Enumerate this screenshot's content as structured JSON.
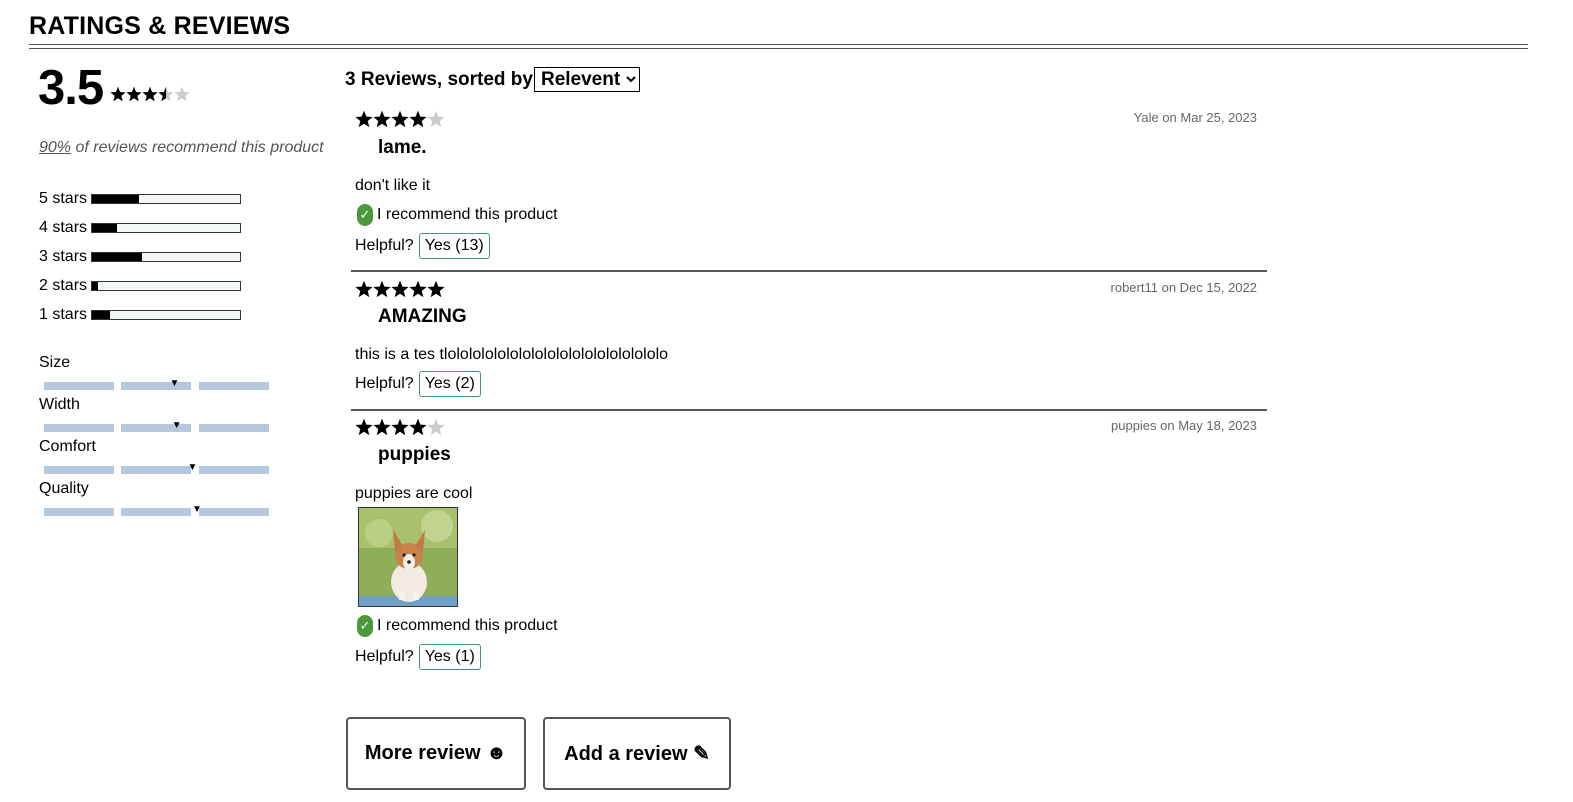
{
  "section": {
    "title": "RATINGS & REVIEWS"
  },
  "summary": {
    "average": "3.5",
    "average_value": 3.5,
    "recommend_pct": "90%",
    "recommend_text": " of reviews recommend this product",
    "breakdown": [
      {
        "label": "5 stars",
        "fraction": 0.32
      },
      {
        "label": "4 stars",
        "fraction": 0.17
      },
      {
        "label": "3 stars",
        "fraction": 0.34
      },
      {
        "label": "2 stars",
        "fraction": 0.04
      },
      {
        "label": "1 stars",
        "fraction": 0.12
      }
    ],
    "characteristics": [
      {
        "name": "Size",
        "value": 0.58
      },
      {
        "name": "Width",
        "value": 0.59
      },
      {
        "name": "Comfort",
        "value": 0.66
      },
      {
        "name": "Quality",
        "value": 0.68
      }
    ]
  },
  "reviews_list": {
    "heading": "3 Reviews, sorted by",
    "sort_options": [
      "Relevent"
    ],
    "sort_selected": "Relevent",
    "reviews": [
      {
        "rating": 4,
        "meta": "Yale on Mar 25, 2023",
        "title": "lame.",
        "body": "don't like it",
        "recommend": "I recommend this product",
        "helpful_label": "Helpful?",
        "helpful_yes": "Yes (13)",
        "has_photo": false
      },
      {
        "rating": 5,
        "meta": "robert11 on Dec 15, 2022",
        "title": "AMAZING",
        "body": "this is a tes tlolololololololololololololololololo",
        "recommend": "",
        "helpful_label": "Helpful?",
        "helpful_yes": "Yes (2)",
        "has_photo": false
      },
      {
        "rating": 4,
        "meta": "puppies on May 18, 2023",
        "title": "puppies",
        "body": "puppies are cool",
        "recommend": "I recommend this product",
        "helpful_label": "Helpful?",
        "helpful_yes": "Yes (1)",
        "has_photo": true
      }
    ]
  },
  "actions": {
    "more_label": "More review ☻",
    "add_label": "Add a review ✎"
  },
  "colors": {
    "star_filled": "#000000",
    "star_empty": "#cccccc",
    "bar_fill": "#000000",
    "char_track": "#b6c8de",
    "recommend_check": "#4a9a3a",
    "helpful_border": "#3a9a6a"
  }
}
